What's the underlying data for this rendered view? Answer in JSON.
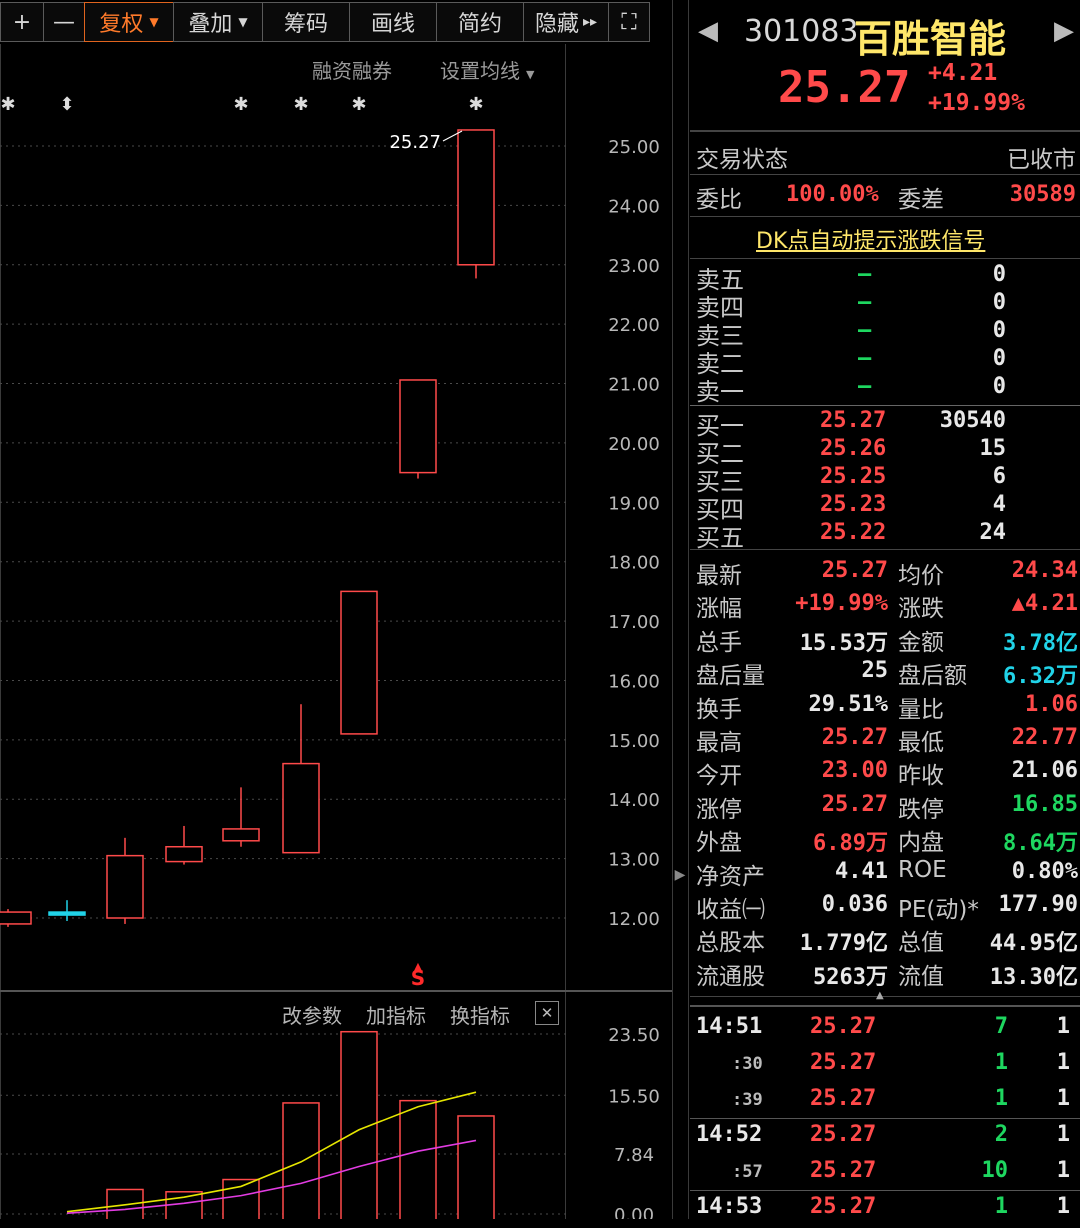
{
  "toolbar": {
    "plus": "+",
    "minus": "—",
    "fuquan": "复权",
    "diejia": "叠加",
    "chouma": "筹码",
    "huaxian": "画线",
    "jianyue": "简约",
    "yincang": "隐藏",
    "hide_arrow": "▸▸",
    "fullscreen": "⛶"
  },
  "chart_header": {
    "margin_label": "融资融券",
    "ma_label": "设置均线"
  },
  "candles": {
    "type": "candlestick",
    "y_ticks": [
      "25.00",
      "24.00",
      "23.00",
      "22.00",
      "21.00",
      "20.00",
      "19.00",
      "18.00",
      "17.00",
      "16.00",
      "15.00",
      "14.00",
      "13.00",
      "12.00"
    ],
    "ylim": [
      11.5,
      25.4
    ],
    "data": [
      {
        "open": 11.9,
        "close": 12.1,
        "high": 12.15,
        "low": 11.85,
        "color": "red"
      },
      {
        "open": 12.1,
        "close": 12.1,
        "high": 12.3,
        "low": 11.95,
        "color": "cyan"
      },
      {
        "open": 12.0,
        "close": 13.05,
        "high": 13.35,
        "low": 11.9,
        "color": "red"
      },
      {
        "open": 12.95,
        "close": 13.2,
        "high": 13.55,
        "low": 12.9,
        "color": "red"
      },
      {
        "open": 13.3,
        "close": 13.5,
        "high": 14.2,
        "low": 13.2,
        "color": "red"
      },
      {
        "open": 13.1,
        "close": 14.6,
        "high": 15.6,
        "low": 13.1,
        "color": "red"
      },
      {
        "open": 15.1,
        "close": 17.5,
        "high": 17.5,
        "low": 15.1,
        "color": "red"
      },
      {
        "open": 19.5,
        "close": 21.06,
        "high": 21.06,
        "low": 19.4,
        "color": "red"
      },
      {
        "open": 23.0,
        "close": 25.27,
        "high": 25.27,
        "low": 22.77,
        "color": "red"
      }
    ],
    "last_label": "25.27",
    "markers": [
      "✱",
      "⬍",
      "✱",
      "✱",
      "✱",
      "✱"
    ],
    "signal": "S"
  },
  "volume_panel": {
    "buttons": [
      "改参数",
      "加指标",
      "换指标"
    ],
    "close": "✕",
    "y_ticks": [
      "23.50",
      "15.50",
      "7.84",
      "0.00"
    ],
    "ylim": [
      0,
      23.5
    ],
    "bars": [
      3.2,
      2.9,
      4.5,
      14.5,
      23.8,
      14.8,
      12.8
    ],
    "ma_yellow": [
      0.3,
      1.2,
      2.2,
      3.6,
      6.8,
      11.0,
      14.0,
      15.9
    ],
    "ma_magenta": [
      0.1,
      0.6,
      1.4,
      2.4,
      4.0,
      6.2,
      8.2,
      9.6
    ]
  },
  "quote": {
    "code": "301083",
    "name": "百胜智能",
    "price": "25.27",
    "change": "+4.21",
    "change_pct": "+19.99%",
    "prev_arrow": "◀",
    "next_arrow": "▶",
    "trade_status_label": "交易状态",
    "trade_status": "已收市",
    "weibi_label": "委比",
    "weibi": "100.00%",
    "weicha_label": "委差",
    "weicha": "30589",
    "dk_link": "DK点自动提示涨跌信号"
  },
  "order_book": {
    "asks": [
      {
        "label": "卖五",
        "price": "—",
        "vol": "0"
      },
      {
        "label": "卖四",
        "price": "—",
        "vol": "0"
      },
      {
        "label": "卖三",
        "price": "—",
        "vol": "0"
      },
      {
        "label": "卖二",
        "price": "—",
        "vol": "0"
      },
      {
        "label": "卖一",
        "price": "—",
        "vol": "0"
      }
    ],
    "bids": [
      {
        "label": "买一",
        "price": "25.27",
        "vol": "30540"
      },
      {
        "label": "买二",
        "price": "25.26",
        "vol": "15"
      },
      {
        "label": "买三",
        "price": "25.25",
        "vol": "6"
      },
      {
        "label": "买四",
        "price": "25.23",
        "vol": "4"
      },
      {
        "label": "买五",
        "price": "25.22",
        "vol": "24"
      }
    ]
  },
  "stats": [
    {
      "l1": "最新",
      "v1": "25.27",
      "c1": "red",
      "l2": "均价",
      "v2": "24.34",
      "c2": "red"
    },
    {
      "l1": "涨幅",
      "v1": "+19.99%",
      "c1": "red",
      "l2": "涨跌",
      "v2": "▲4.21",
      "c2": "red"
    },
    {
      "l1": "总手",
      "v1": "15.53万",
      "c1": "white",
      "l2": "金额",
      "v2": "3.78亿",
      "c2": "cyan"
    },
    {
      "l1": "盘后量",
      "v1": "25",
      "c1": "white",
      "l2": "盘后额",
      "v2": "6.32万",
      "c2": "cyan"
    },
    {
      "l1": "换手",
      "v1": "29.51%",
      "c1": "white",
      "l2": "量比",
      "v2": "1.06",
      "c2": "red"
    },
    {
      "l1": "最高",
      "v1": "25.27",
      "c1": "red",
      "l2": "最低",
      "v2": "22.77",
      "c2": "red"
    },
    {
      "l1": "今开",
      "v1": "23.00",
      "c1": "red",
      "l2": "昨收",
      "v2": "21.06",
      "c2": "white"
    },
    {
      "l1": "涨停",
      "v1": "25.27",
      "c1": "red",
      "l2": "跌停",
      "v2": "16.85",
      "c2": "green"
    },
    {
      "l1": "外盘",
      "v1": "6.89万",
      "c1": "red",
      "l2": "内盘",
      "v2": "8.64万",
      "c2": "green"
    },
    {
      "l1": "净资产",
      "v1": "4.41",
      "c1": "white",
      "l2": "ROE",
      "v2": "0.80%",
      "c2": "white"
    },
    {
      "l1": "收益㈠",
      "v1": "0.036",
      "c1": "white",
      "l2": "PE(动)*",
      "v2": "177.90",
      "c2": "white"
    },
    {
      "l1": "总股本",
      "v1": "1.779亿",
      "c1": "white",
      "l2": "总值",
      "v2": "44.95亿",
      "c2": "white"
    },
    {
      "l1": "流通股",
      "v1": "5263万",
      "c1": "white",
      "l2": "流值",
      "v2": "13.30亿",
      "c2": "white"
    }
  ],
  "ticks": [
    {
      "time": "14:51",
      "price": "25.27",
      "vol": "7",
      "n": "1"
    },
    {
      "time": ":30",
      "price": "25.27",
      "vol": "1",
      "n": "1"
    },
    {
      "time": ":39",
      "price": "25.27",
      "vol": "1",
      "n": "1"
    },
    {
      "time": "14:52",
      "price": "25.27",
      "vol": "2",
      "n": "1"
    },
    {
      "time": ":57",
      "price": "25.27",
      "vol": "10",
      "n": "1"
    },
    {
      "time": "14:53",
      "price": "25.27",
      "vol": "1",
      "n": "1"
    }
  ],
  "colors": {
    "up": "#ff4a4a",
    "down_cyan": "#21d3e8",
    "ma_yellow": "#e6e600",
    "ma_magenta": "#e23ce2"
  }
}
